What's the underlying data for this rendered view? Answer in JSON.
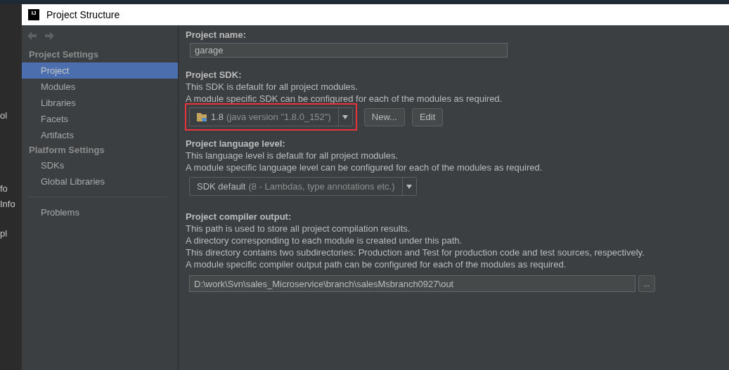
{
  "background_ide": {
    "side_fragments": [
      "ol",
      "fo",
      "Info",
      "pl"
    ]
  },
  "window": {
    "logo": "IJ",
    "title": "Project Structure"
  },
  "sidebar": {
    "sections": [
      {
        "title": "Project Settings",
        "items": [
          {
            "label": "Project",
            "selected": true
          },
          {
            "label": "Modules",
            "selected": false
          },
          {
            "label": "Libraries",
            "selected": false
          },
          {
            "label": "Facets",
            "selected": false
          },
          {
            "label": "Artifacts",
            "selected": false
          }
        ]
      },
      {
        "title": "Platform Settings",
        "items": [
          {
            "label": "SDKs",
            "selected": false
          },
          {
            "label": "Global Libraries",
            "selected": false
          }
        ]
      }
    ],
    "footer_items": [
      {
        "label": "Problems",
        "selected": false
      }
    ]
  },
  "project_name": {
    "label": "Project name:",
    "value": "garage"
  },
  "project_sdk": {
    "label": "Project SDK:",
    "lines": [
      "This SDK is default for all project modules.",
      "A module specific SDK can be configured for each of the modules as required."
    ],
    "dropdown": {
      "version": "1.8",
      "detail": "(java version \"1.8.0_152\")",
      "highlighted": true
    },
    "buttons": [
      "New...",
      "Edit"
    ]
  },
  "language_level": {
    "label": "Project language level:",
    "lines": [
      "This language level is default for all project modules.",
      "A module specific language level can be configured for each of the modules as required."
    ],
    "dropdown": {
      "value": "SDK default",
      "detail": "(8 - Lambdas, type annotations etc.)"
    }
  },
  "compiler_output": {
    "label": "Project compiler output:",
    "lines": [
      "This path is used to store all project compilation results.",
      "A directory corresponding to each module is created under this path.",
      "This directory contains two subdirectories: Production and Test for production code and test sources, respectively.",
      "A module specific compiler output path can be configured for each of the modules as required."
    ],
    "path": "D:\\work\\Svn\\sales_Microservice\\branch\\salesMsbranch0927\\out",
    "browse_button": "..."
  }
}
